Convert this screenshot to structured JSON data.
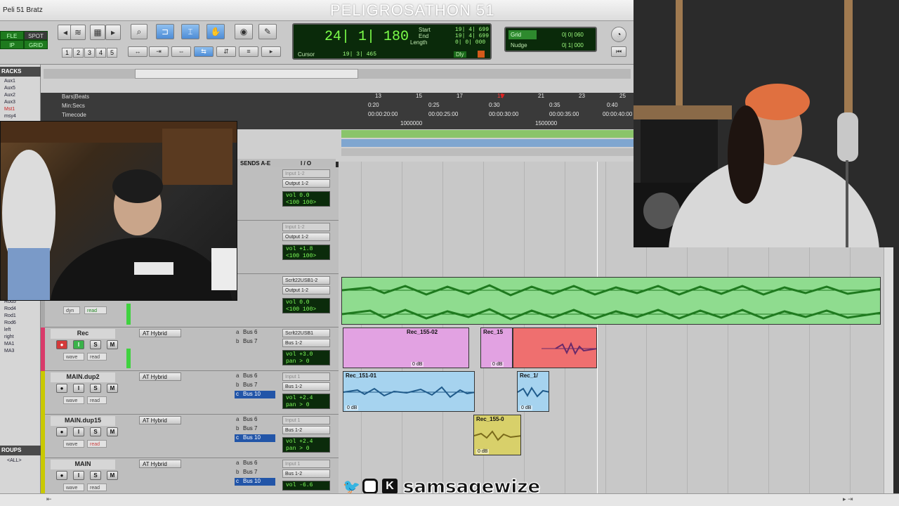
{
  "window": {
    "title": "Peli 51 Bratz"
  },
  "stream": {
    "title": "PELIGROSATHON 51",
    "handle": "samsagewize"
  },
  "modes": {
    "shuffle": "FLE",
    "spot": "SPOT",
    "slip": "IP",
    "grid": "GRID"
  },
  "tool_numbers": [
    "1",
    "2",
    "3",
    "4",
    "5"
  ],
  "counter": {
    "main": "24| 1| 180",
    "start_label": "Start",
    "end_label": "End",
    "length_label": "Length",
    "start": "19| 4| 699",
    "end": "19| 4| 699",
    "length": "0| 0| 000",
    "cursor_label": "Cursor",
    "cursor": "19| 3| 465",
    "dly_label": "Dly"
  },
  "grid": {
    "grid_label": "Grid",
    "grid_value": "0| 0| 060",
    "nudge_label": "Nudge",
    "nudge_value": "0| 1| 000"
  },
  "left_panel": {
    "tracks_header": "RACKS",
    "items_top": [
      "Aux1",
      "Aux5",
      "Aux2",
      "Aux3",
      "Mst1",
      "msy4"
    ],
    "items_bottom": [
      "Rod5",
      "Rod4",
      "Rod1",
      "Rod6",
      "left",
      "right",
      "MA1",
      "MA3"
    ],
    "groups_header": "ROUPS",
    "groups_all": "<ALL>"
  },
  "ruler": {
    "bars_label": "Bars|Beats",
    "minsecs_label": "Min:Secs",
    "timecode_label": "Timecode",
    "bars": [
      "13",
      "15",
      "17",
      "19",
      "21",
      "23",
      "25"
    ],
    "minsecs": [
      "0:20",
      "0:25",
      "0:30",
      "0:35",
      "0:40"
    ],
    "timecode": [
      "00:00:20:00",
      "00:00:25:00",
      "00:00:30:00",
      "00:00:35:00",
      "00:00:40:00"
    ],
    "samples": [
      "1000000",
      "1500000"
    ]
  },
  "mixer_headers": {
    "sends": "SENDS A-E",
    "io": "I / O"
  },
  "strips": [
    {
      "name": "",
      "input": "Input 1-2",
      "output": "Output 1-2",
      "vol": "vol  0.0",
      "pan": "<100  100>"
    },
    {
      "name": "",
      "input": "Input 1-2",
      "output": "Output 1-2",
      "vol": "vol  +1.8",
      "pan": "<100  100>"
    },
    {
      "name": "",
      "input": "Scrlt22USB1-2",
      "output": "Output 1-2",
      "vol": "vol  0.0",
      "pan": "<100  100>",
      "dyn": "dyn",
      "read": "read"
    },
    {
      "name": "Rec",
      "insert": "AT Hybrid",
      "sends": [
        {
          "l": "a",
          "v": "Bus 6"
        },
        {
          "l": "b",
          "v": "Bus 7"
        }
      ],
      "input": "Scrlt22USB1",
      "output": "Bus 1-2",
      "vol": "vol  +3.0",
      "pan": "pan  > 0",
      "wave": "wave",
      "read": "read"
    },
    {
      "name": "MAIN.dup2",
      "insert": "AT Hybrid",
      "sends": [
        {
          "l": "a",
          "v": "Bus 6"
        },
        {
          "l": "b",
          "v": "Bus 7"
        },
        {
          "l": "c",
          "v": "Bus 10"
        }
      ],
      "input": "Input 1",
      "output": "Bus 1-2",
      "vol": "vol  +2.4",
      "pan": "pan  > 0",
      "wave": "wave",
      "read": "read"
    },
    {
      "name": "MAIN.dup15",
      "insert": "AT Hybrid",
      "sends": [
        {
          "l": "a",
          "v": "Bus 6"
        },
        {
          "l": "b",
          "v": "Bus 7"
        },
        {
          "l": "c",
          "v": "Bus 10"
        }
      ],
      "input": "Input 1",
      "output": "Bus 1-2",
      "vol": "vol  +2.4",
      "pan": "pan  > 0",
      "wave": "wave",
      "read": "read"
    },
    {
      "name": "MAIN",
      "insert": "AT Hybrid",
      "sends": [
        {
          "l": "a",
          "v": "Bus 6"
        },
        {
          "l": "b",
          "v": "Bus 7"
        },
        {
          "l": "c",
          "v": "Bus 10"
        }
      ],
      "input": "Input 1",
      "output": "Bus 1-2",
      "vol": "vol  -6.6",
      "wave": "wave",
      "read": "read"
    }
  ],
  "button_labels": {
    "s": "S",
    "m": "M",
    "i": "I"
  },
  "clips": {
    "beat": "",
    "rec_a": "Rec_155-02",
    "rec_b": "Rec_15",
    "main2_a": "Rec_151-01",
    "main2_b": "Rec_1/",
    "main15": "Rec_155-0",
    "gain": "0 dB"
  },
  "colors": {
    "beat": "#8fdc8f",
    "rec_pink": "#e2a2e2",
    "rec_red": "#ef6f6f",
    "main_blue": "#a6d3ef",
    "main_yellow": "#d8d06a"
  }
}
